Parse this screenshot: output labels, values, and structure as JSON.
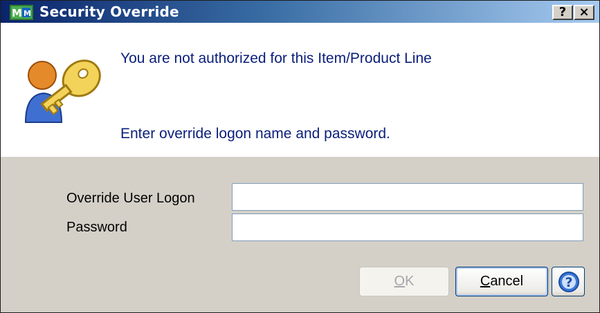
{
  "window": {
    "title": "Security Override",
    "help_button": "?",
    "close_button": "×"
  },
  "message": {
    "line1": "You are not authorized for this Item/Product Line",
    "line2": "Enter override logon name and password."
  },
  "form": {
    "user_logon_label": "Override User Logon",
    "user_logon_value": "",
    "password_label": "Password",
    "password_value": ""
  },
  "buttons": {
    "ok_mnemonic": "O",
    "ok_rest": "K",
    "ok_enabled": false,
    "cancel_mnemonic": "C",
    "cancel_rest": "ancel",
    "help_glyph": "?"
  },
  "colors": {
    "title_gradient_start": "#0a246a",
    "title_gradient_end": "#a6caf0",
    "message_text": "#0a1e7a",
    "dialog_face": "#d4d0c8"
  },
  "icons": {
    "app": "sage-mas-app-icon",
    "banner": "user-key-icon",
    "help": "help-circle-icon"
  }
}
